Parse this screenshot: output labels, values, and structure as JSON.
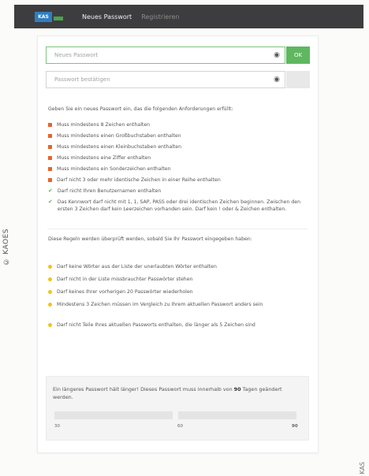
{
  "credits": {
    "left": "© KAOES",
    "right": "KAS"
  },
  "header": {
    "logo_text": "KAS",
    "active_tab": "Neues Passwort",
    "inactive_tab": "Registrieren"
  },
  "form": {
    "new_password": {
      "placeholder": "Neues Passwort",
      "value": ""
    },
    "confirm_password": {
      "placeholder": "Passwort bestätigen",
      "value": ""
    },
    "ok_label": "OK",
    "eye_icon": "eye-icon"
  },
  "intro": "Geben Sie ein neues Passwort ein, das die folgenden Anforderungen erfüllt:",
  "requirements": [
    {
      "status": "unmet",
      "text": "Muss mindestens 8 Zeichen enthalten"
    },
    {
      "status": "unmet",
      "text": "Muss mindestens einen Großbuchstaben enthalten"
    },
    {
      "status": "unmet",
      "text": "Muss mindestens einen Kleinbuchstaben enthalten"
    },
    {
      "status": "unmet",
      "text": "Muss mindestens eine Ziffer enthalten"
    },
    {
      "status": "unmet",
      "text": "Muss mindestens ein Sonderzeichen enthalten"
    },
    {
      "status": "unmet",
      "text": "Darf nicht 3 oder mehr identische Zeichen in einer Reihe enthalten"
    },
    {
      "status": "met",
      "text": "Darf nicht Ihren Benutzernamen enthalten"
    },
    {
      "status": "met",
      "text": "Das Kennwort darf nicht mit 1, 1, SAP, PASS oder drei identischen Zeichen beginnen. Zwischen den ersten 3 Zeichen darf kein Leerzeichen vorhanden sein. Darf kein ! oder & Zeichen enthalten."
    }
  ],
  "server_intro": "Diese Regeln werden überprüft werden, sobald Sie Ihr Passwort eingegeben haben:",
  "server_rules": [
    "Darf keine Wörter aus der Liste der unerlaubten Wörter enthalten",
    "Darf nicht in der Liste missbrauchter Passwörter stehen",
    "Darf keines Ihrer vorherigen 20 Passwörter wiederholen",
    "Mindestens 3 Zeichen müssen im Vergleich zu Ihrem aktuellen Passwort anders sein",
    "Darf nicht Teile Ihres aktuellen Passworts enthalten, die länger als 5 Zeichen sind"
  ],
  "strength": {
    "text_before": "Ein längeres Passwort hält länger! Dieses Passwort muss innerhalb von ",
    "days": "90",
    "text_after": " Tagen geändert werden.",
    "ticks": [
      "30",
      "60",
      "90"
    ]
  }
}
